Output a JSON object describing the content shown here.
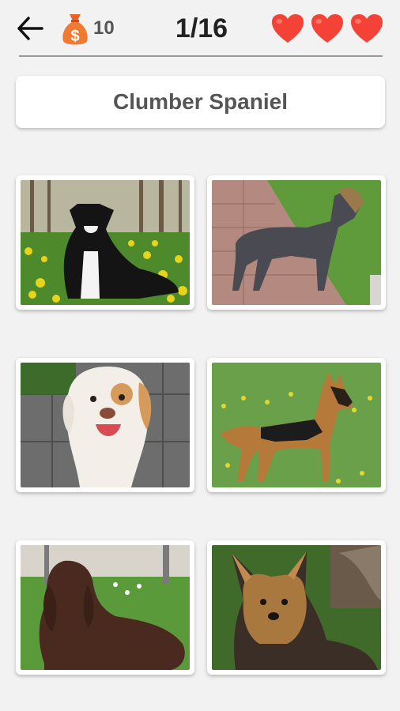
{
  "header": {
    "back_icon": "arrow-left-icon",
    "coins": {
      "icon": "money-bag-icon",
      "count": "10",
      "bag_symbol": "$"
    },
    "progress": "1/16",
    "lives": {
      "count": 3,
      "icon": "heart-icon",
      "color": "#f44336"
    }
  },
  "question": {
    "text": "Clumber Spaniel"
  },
  "options": [
    {
      "subject": "black and white dog sitting in a field of yellow flowers"
    },
    {
      "subject": "grey wiry-coated dog standing on a brick path"
    },
    {
      "subject": "white and orange spaniel close-up on paving stones"
    },
    {
      "subject": "german shepherd standing on grass with dandelions"
    },
    {
      "subject": "brown long-haired dog lying on grass"
    },
    {
      "subject": "yorkshire terrier sitting outdoors"
    }
  ],
  "colors": {
    "background": "#f2f2f2",
    "accent_orange": "#f07a32",
    "heart": "#f44336",
    "text_dark": "#222222",
    "text_grey": "#555555"
  }
}
